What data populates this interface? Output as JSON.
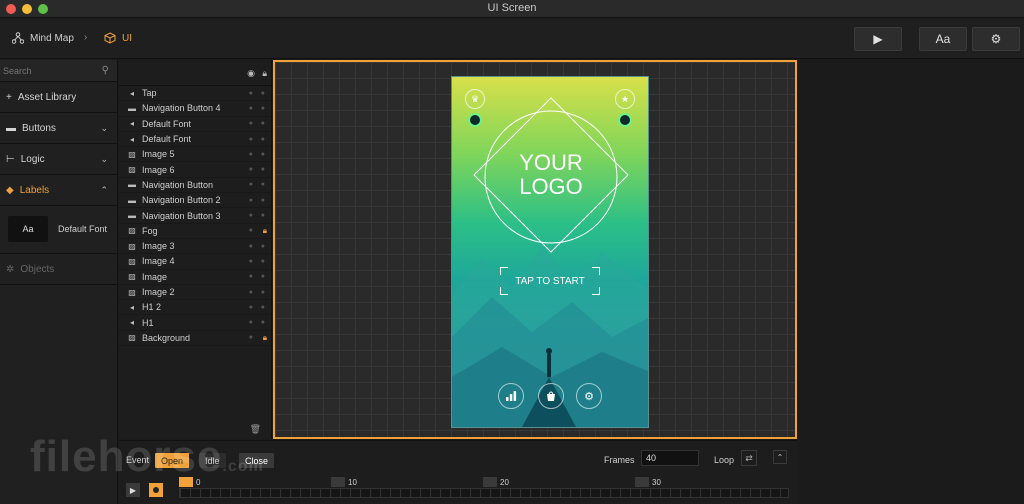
{
  "window": {
    "title": "UI Screen"
  },
  "breadcrumb": {
    "root": "Mind Map",
    "separator": "›",
    "current": "UI"
  },
  "toolbar": {
    "play_icon": "▶",
    "font_label": "Aa",
    "gear_icon": "⚙"
  },
  "left_panel": {
    "search_placeholder": "Search",
    "rows": [
      {
        "label": "Asset Library",
        "icon": "+"
      },
      {
        "label": "Buttons",
        "icon": "▬"
      },
      {
        "label": "Logic",
        "icon": "⊢"
      },
      {
        "label": "Labels",
        "icon": "◆"
      }
    ],
    "label_card": {
      "icon_text": "Aa",
      "text": "Default Font"
    },
    "objects_label": "Objects"
  },
  "layers": {
    "items": [
      {
        "name": "Tap",
        "icon": "◂",
        "locked": false
      },
      {
        "name": "Navigation Button 4",
        "icon": "▬",
        "locked": false
      },
      {
        "name": "Default Font",
        "icon": "◂",
        "locked": false
      },
      {
        "name": "Default Font",
        "icon": "◂",
        "locked": false
      },
      {
        "name": "Image 5",
        "icon": "▨",
        "locked": false
      },
      {
        "name": "Image 6",
        "icon": "▨",
        "locked": false
      },
      {
        "name": "Navigation Button",
        "icon": "▬",
        "locked": false
      },
      {
        "name": "Navigation Button 2",
        "icon": "▬",
        "locked": false
      },
      {
        "name": "Navigation Button 3",
        "icon": "▬",
        "locked": false
      },
      {
        "name": "Fog",
        "icon": "▨",
        "locked": true
      },
      {
        "name": "Image 3",
        "icon": "▨",
        "locked": false
      },
      {
        "name": "Image 4",
        "icon": "▨",
        "locked": false
      },
      {
        "name": "Image",
        "icon": "▨",
        "locked": false
      },
      {
        "name": "Image 2",
        "icon": "▨",
        "locked": false
      },
      {
        "name": "H1 2",
        "icon": "◂",
        "locked": false
      },
      {
        "name": "H1",
        "icon": "◂",
        "locked": false
      },
      {
        "name": "Background",
        "icon": "▨",
        "locked": true
      }
    ]
  },
  "phone": {
    "logo_line1": "YOUR",
    "logo_line2": "LOGO",
    "tap_label": "TAP TO START"
  },
  "bottom": {
    "event_label": "Event",
    "events": [
      "Open",
      "Idle",
      "Close"
    ],
    "frames_label": "Frames",
    "frames_value": "40",
    "loop_label": "Loop",
    "timeline_marks": [
      "0",
      "10",
      "20",
      "30"
    ]
  },
  "watermark": {
    "main": "filehorse",
    "suffix": ".com"
  },
  "colors": {
    "accent": "#f0a13a",
    "handle": "#6ef08a"
  }
}
